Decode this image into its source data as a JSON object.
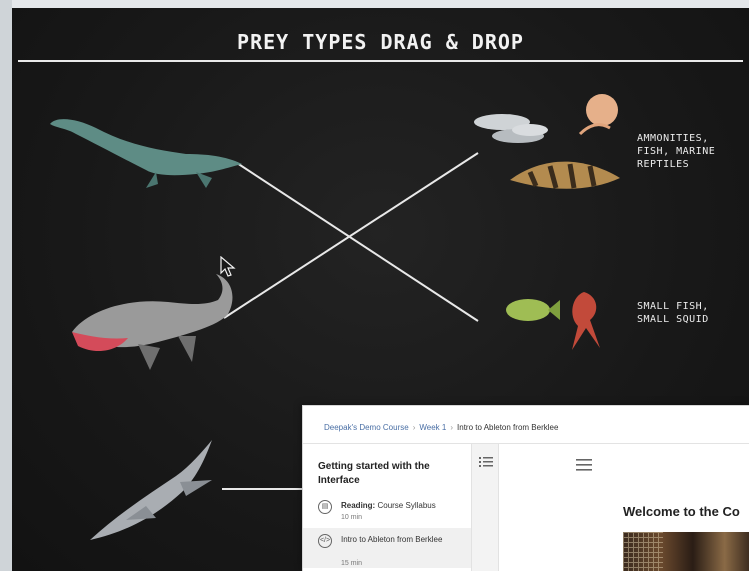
{
  "board": {
    "title": "PREY TYPES DRAG & DROP",
    "answers": [
      "AMMONITIES,\nFISH, MARINE\nREPTILES",
      "SMALL FISH,\nSMALL SQUID"
    ]
  },
  "course": {
    "breadcrumb": [
      "Deepak's Demo Course",
      "Week 1",
      "Intro to Ableton from Berklee"
    ],
    "nav_title": "Getting started with the Interface",
    "items": [
      {
        "type": "Reading:",
        "label": "Course Syllabus",
        "duration": "10 min",
        "icon": "book-icon"
      },
      {
        "type": "",
        "label": "Intro to Ableton from Berklee",
        "duration": "15 min",
        "icon": "code-icon"
      }
    ],
    "welcome": "Welcome to the Co"
  },
  "colors": {
    "board_bg": "#1b1b1b",
    "chalk": "#f0f0f0",
    "link": "#4a6fa5"
  }
}
